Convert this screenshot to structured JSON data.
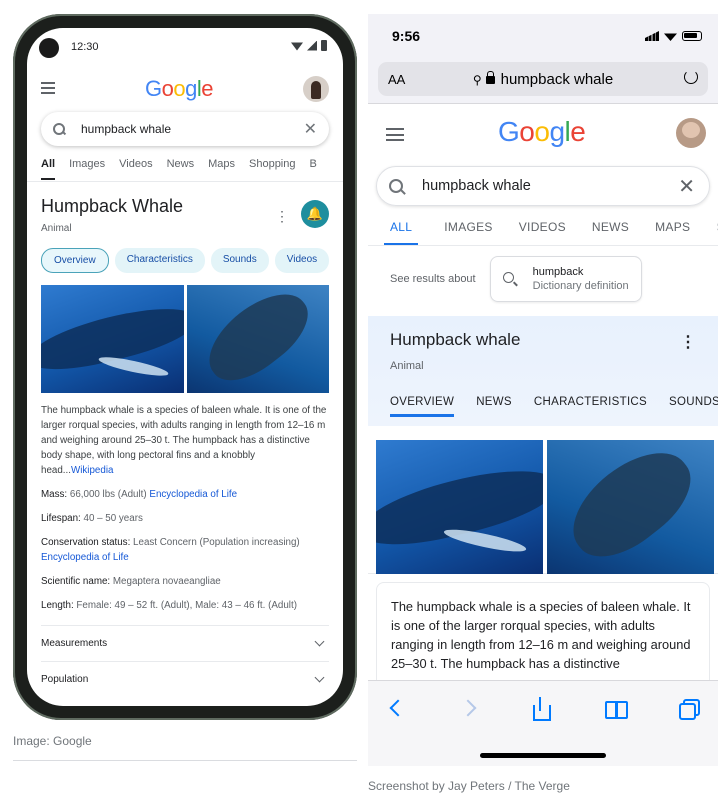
{
  "left_phone": {
    "status": {
      "time": "12:30"
    },
    "logo": [
      "G",
      "o",
      "o",
      "g",
      "l",
      "e"
    ],
    "search": {
      "query": "humpback whale"
    },
    "tabs": [
      "All",
      "Images",
      "Videos",
      "News",
      "Maps",
      "Shopping",
      "B"
    ],
    "entity": {
      "title": "Humpback Whale",
      "subtitle": "Animal"
    },
    "chips": [
      "Overview",
      "Characteristics",
      "Sounds",
      "Videos"
    ],
    "description": "The humpback whale is a species of baleen whale. It is one of the larger rorqual species, with adults ranging in length from 12–16 m and weighing around 25–30 t. The humpback has a distinctive body shape, with long pectoral fins and a knobbly head...",
    "description_link": "Wikipedia",
    "facts": [
      {
        "key": "Mass:",
        "value": "66,000 lbs (Adult)",
        "link": "Encyclopedia of Life"
      },
      {
        "key": "Lifespan:",
        "value": "40 – 50 years",
        "link": ""
      },
      {
        "key": "Conservation status:",
        "value": "Least Concern (Population increasing)",
        "link": "Encyclopedia of Life"
      },
      {
        "key": "Scientific name:",
        "value": "Megaptera novaeangliae",
        "link": ""
      },
      {
        "key": "Length:",
        "value": "Female: 49 – 52 ft. (Adult), Male: 43 – 46 ft. (Adult)",
        "link": ""
      }
    ],
    "accordions": [
      "Measurements",
      "Population"
    ]
  },
  "caption_left": "Image: Google",
  "right_phone": {
    "status": {
      "time": "9:56"
    },
    "urlbar": {
      "aa": "AA",
      "url": "humpback whale"
    },
    "search": {
      "query": "humpback whale"
    },
    "tabs": [
      "ALL",
      "IMAGES",
      "VIDEOS",
      "NEWS",
      "MAPS",
      "S"
    ],
    "see_results_label": "See results about",
    "dictionary": {
      "term": "humpback",
      "type": "Dictionary definition"
    },
    "entity": {
      "title": "Humpback whale",
      "subtitle": "Animal"
    },
    "kp_tabs": [
      "OVERVIEW",
      "NEWS",
      "CHARACTERISTICS",
      "SOUNDS"
    ],
    "description": "The humpback whale is a species of baleen whale. It is one of the larger rorqual species, with adults ranging in length from 12–16 m and weighing around 25–30 t. The humpback has a distinctive"
  },
  "caption_right": "Screenshot by Jay Peters / The Verge",
  "colors": {
    "google_blue": "#4285f4",
    "google_red": "#ea4335",
    "google_yellow": "#fbbc05",
    "google_green": "#34a853",
    "link_blue": "#1558d6",
    "ios_blue": "#007aff"
  }
}
